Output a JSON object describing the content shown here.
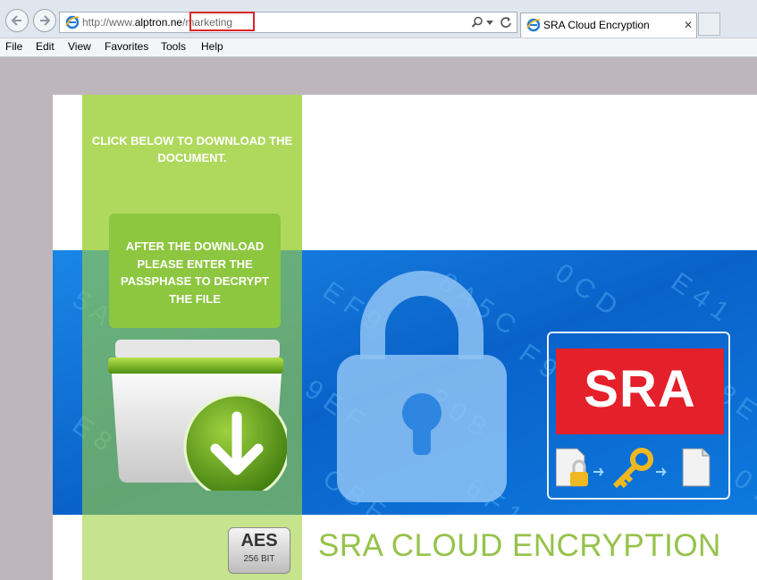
{
  "browser": {
    "url_prefix": "http://www.",
    "url_domain": "alptron.ne",
    "url_path": "/marketing",
    "tab_title": "SRA Cloud Encryption",
    "tab_close": "✕"
  },
  "menu": [
    "File",
    "Edit",
    "View",
    "Favorites",
    "Tools",
    "Help"
  ],
  "page": {
    "click_text": "CLICK BELOW TO DOWNLOAD THE DOCUMENT.",
    "instructions": "AFTER THE DOWNLOAD PLEASE ENTER THE PASSPHASE TO DECRYPT THE FILE",
    "sra_logo": "SRA",
    "aes_label": "AES",
    "aes_bits": "256 BIT",
    "heading": "SRA CLOUD ENCRYPTION"
  },
  "colors": {
    "accent_green": "#96c24a",
    "hero_blue": "#0f74d8",
    "sra_red": "#e4202a",
    "highlight_red": "#d9262b"
  }
}
